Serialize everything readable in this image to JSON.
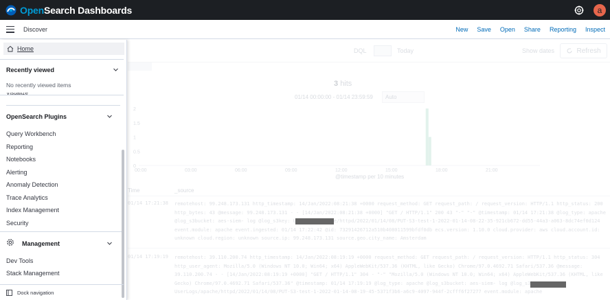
{
  "app": {
    "brand_prefix": "Open",
    "brand_suffix": "Search Dashboards"
  },
  "user": {
    "avatar_letter": "a"
  },
  "breadcrumb": {
    "current": "Discover"
  },
  "top_menu": {
    "items": [
      "New",
      "Save",
      "Open",
      "Share",
      "Reporting",
      "Inspect"
    ]
  },
  "query_bar": {
    "language": "DQL",
    "date_text": "Today",
    "show_dates": "Show dates",
    "refresh": "Refresh"
  },
  "results": {
    "hit_count": "3",
    "hits_label": "hits",
    "date_range": "01/14 00:00:00 - 01/14 23:59:59",
    "interval": "Auto"
  },
  "chart_data": {
    "type": "bar",
    "y_ticks": [
      "2",
      "1.5",
      "1",
      "0.5",
      "0"
    ],
    "x_ticks": [
      "00:00",
      "03:00",
      "06:00",
      "09:00",
      "12:00",
      "15:00",
      "18:00",
      "21:00"
    ],
    "xlabel": "@timestamp per 10 minutes",
    "ylim": [
      0,
      2
    ],
    "bars": [
      {
        "time": "17:10",
        "value": 2
      },
      {
        "time": "17:20",
        "value": 1
      }
    ]
  },
  "table": {
    "headers": [
      "Time",
      "_source"
    ],
    "rows": [
      {
        "time": "01/14 17:21:38",
        "source": "remotehost: 99.248.173.131 http_timestamp: 14/Jan/2022:08:21:38 +0000 request_method: GET request_path: / request_version: HTTP/1.1 http_status: 200 http_bytes: 43 @message: 99.248.173.131 - - [14/Jan/2022:08:21:38 +0000] \"GET / HTTP/1.1\" 200 43 \"-\" \"-\" @timestamp: 01/14 17:21:38 @log_type: apache @log_s3bucket: aes-siem- log @log_s3key: UserLogs/apache/httpd/2022/01/14/08/PUT-S3-test-1-2022-01-14-08-22-35-921cb672-dd55-44a3-a063-8dc74ef0d124 event.module: apache event.ingested: 01/14 17:22:42 @id: 73291426712a510b408011599bfdf0db ecs.version: 1.10.0 cloud.provider: aws cloud.account.id: unknown cloud.region: unknown source.ip: 99.248.173.131 source.geo.city_name: Amsterdam"
      },
      {
        "time": "01/14 17:19:19",
        "source": "remotehost: 39.110.200.74 http_timestamp: 14/Jan/2022:08:19:19 +0000 request_method: GET request_path: / request_version: HTTP/1.1 http_status: 304 http_user_agent: Mozilla/5.0 (Windows NT 10.0; Win64; x64) AppleWebKit/537.36 (KHTML, like Gecko) Chrome/97.0.4692.71 Safari/537.36 @message: 39.110.200.74 - - [14/Jan/2022:08:19:19 +0000] \"GET / HTTP/1.1\" 304 - \"-\" \"Mozilla/5.0 (Windows NT 10.0; Win64; x64) AppleWebKit/537.36 (KHTML, like Gecko) Chrome/97.0.4692.71 Safari/537.36\" @timestamp: 01/14 17:19:19 @log_type: apache @log_s3bucket: aes-siem- log @log_s3key: UserLogs/apache/httpd/2022/01/14/08/PUT-S3-test-1-2022-01-14-08-19-45-5371f3b6-a6c9-4097-944f-2cfff6f27277 event.module: apache"
      }
    ]
  },
  "nav": {
    "home": "Home",
    "recently_viewed": {
      "title": "Recently viewed",
      "empty": "No recently viewed items",
      "partial_item": "Visualize"
    },
    "plugins": {
      "title": "OpenSearch Plugins",
      "items": [
        "Query Workbench",
        "Reporting",
        "Notebooks",
        "Alerting",
        "Anomaly Detection",
        "Trace Analytics",
        "Index Management",
        "Security"
      ]
    },
    "management": {
      "title": "Management",
      "items": [
        "Dev Tools",
        "Stack Management"
      ]
    },
    "dock": "Dock navigation"
  },
  "colors": {
    "header_bg": "#1c1f23",
    "brand_blue": "#009bd6",
    "link": "#006bb8",
    "avatar": "#e7664c",
    "bar": "#54b399"
  }
}
